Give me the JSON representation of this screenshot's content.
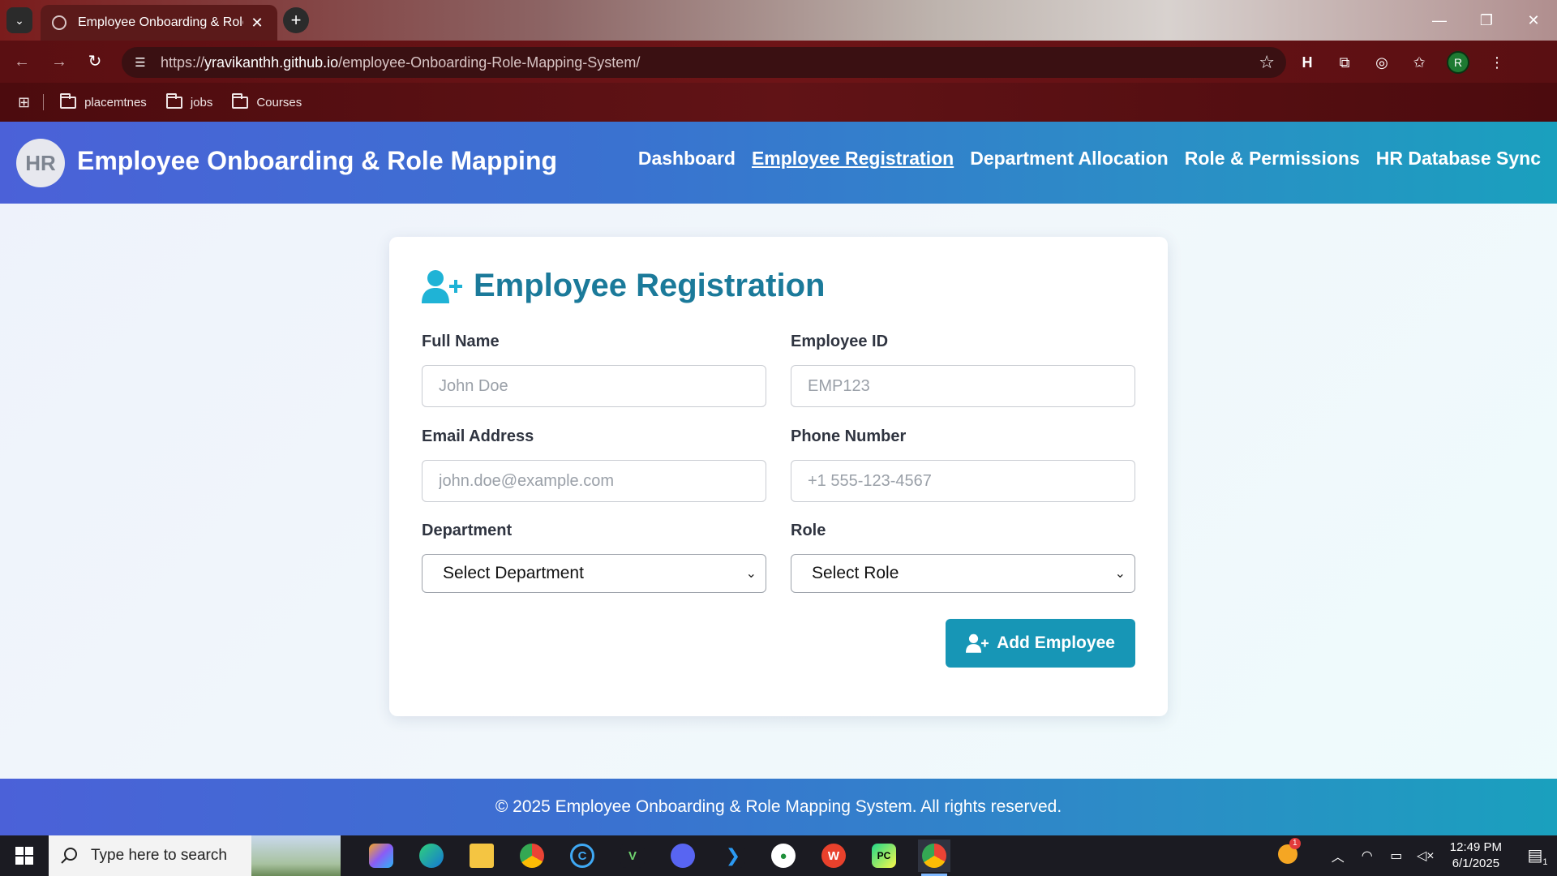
{
  "browser": {
    "tab_title": "Employee Onboarding & Role Mapping",
    "close_glyph": "✕",
    "new_tab_glyph": "+",
    "url_scheme": "https://",
    "url_host": "yravikanthh.github.io",
    "url_path": "/employee-Onboarding-Role-Mapping-System/",
    "profile_initial": "R",
    "bookmarks": [
      "placemtnes",
      "jobs",
      "Courses"
    ]
  },
  "app": {
    "logo_text": "HR",
    "title": "Employee Onboarding & Role Mapping",
    "nav": [
      {
        "label": "Dashboard",
        "active": false
      },
      {
        "label": "Employee Registration",
        "active": true
      },
      {
        "label": "Department Allocation",
        "active": false
      },
      {
        "label": "Role & Permissions",
        "active": false
      },
      {
        "label": "HR Database Sync",
        "active": false
      }
    ]
  },
  "form": {
    "heading": "Employee Registration",
    "full_name": {
      "label": "Full Name",
      "placeholder": "John Doe"
    },
    "employee_id": {
      "label": "Employee ID",
      "placeholder": "EMP123"
    },
    "email": {
      "label": "Email Address",
      "placeholder": "john.doe@example.com"
    },
    "phone": {
      "label": "Phone Number",
      "placeholder": "+1 555-123-4567"
    },
    "department": {
      "label": "Department",
      "selected": "Select Department"
    },
    "role": {
      "label": "Role",
      "selected": "Select Role"
    },
    "submit_label": "Add Employee"
  },
  "footer": {
    "text": "© 2025 Employee Onboarding & Role Mapping System. All rights reserved."
  },
  "taskbar": {
    "search_placeholder": "Type here to search",
    "time": "12:49 PM",
    "date": "6/1/2025",
    "notification_count": "1",
    "weather_badge": "1"
  },
  "colors": {
    "accent": "#1796b6",
    "heading": "#1b7a9a",
    "header_gradient_start": "#4b61d8",
    "header_gradient_end": "#1aa0be"
  }
}
